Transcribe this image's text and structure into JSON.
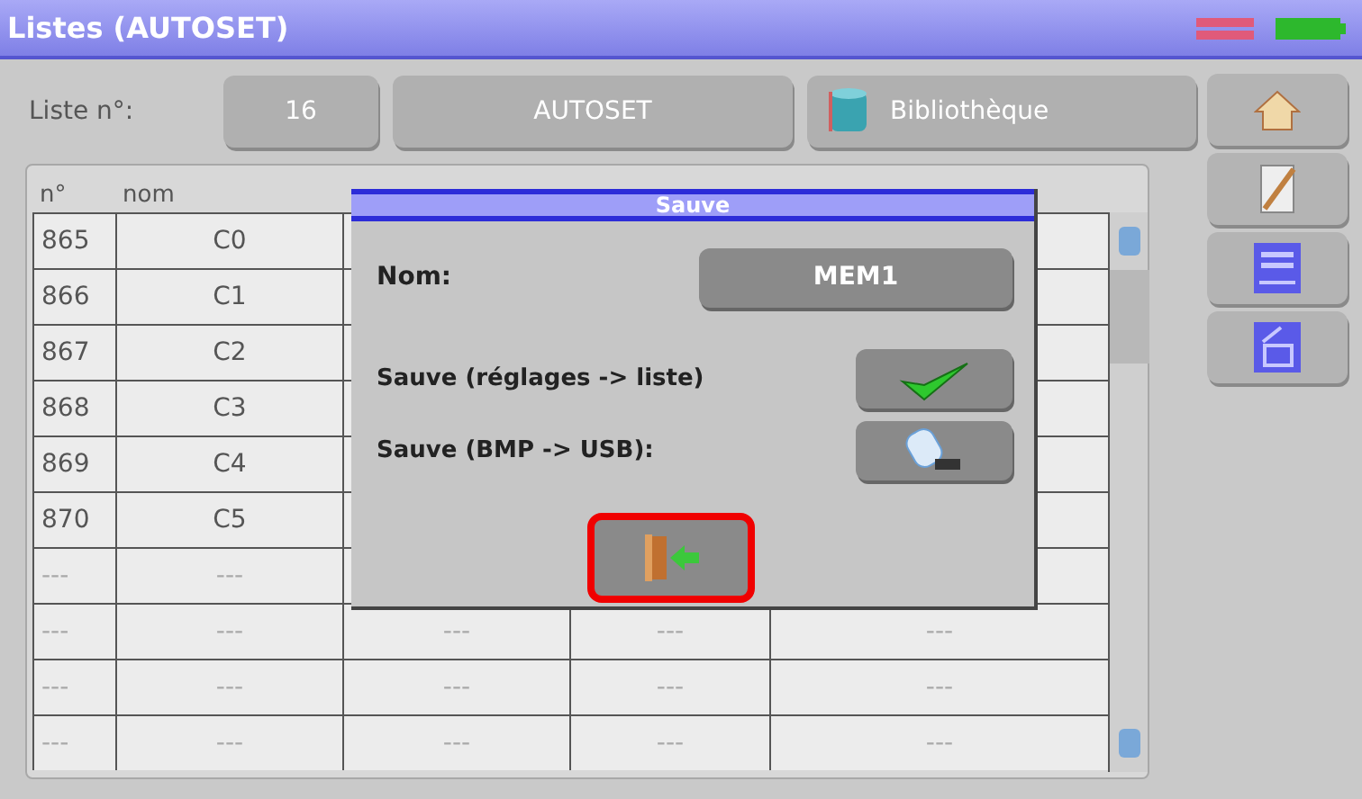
{
  "window": {
    "title": "Listes (AUTOSET)"
  },
  "toolbar": {
    "label": "Liste n°:",
    "number": "16",
    "name": "AUTOSET",
    "library": "Bibliothèque"
  },
  "table": {
    "columns": [
      "n°",
      "nom"
    ],
    "rows": [
      {
        "cells": [
          "865",
          "C0"
        ]
      },
      {
        "cells": [
          "866",
          "C1"
        ]
      },
      {
        "cells": [
          "867",
          "C2"
        ]
      },
      {
        "cells": [
          "868",
          "C3"
        ]
      },
      {
        "cells": [
          "869",
          "C4"
        ]
      },
      {
        "cells": [
          "870",
          "C5"
        ]
      },
      {
        "cells": [
          "---",
          "---"
        ]
      },
      {
        "cells": [
          "---",
          "---",
          "---",
          "---",
          "---"
        ]
      },
      {
        "cells": [
          "---",
          "---",
          "---",
          "---",
          "---"
        ]
      },
      {
        "cells": [
          "---",
          "---",
          "---",
          "---",
          "---"
        ]
      }
    ]
  },
  "dialog": {
    "title": "Sauve",
    "name_label": "Nom:",
    "name_value": "MEM1",
    "actions": [
      {
        "label": "Sauve (réglages -> liste)",
        "kind": "check"
      },
      {
        "label": "Sauve (BMP -> USB):",
        "kind": "usb"
      }
    ],
    "exit_highlighted": true
  }
}
